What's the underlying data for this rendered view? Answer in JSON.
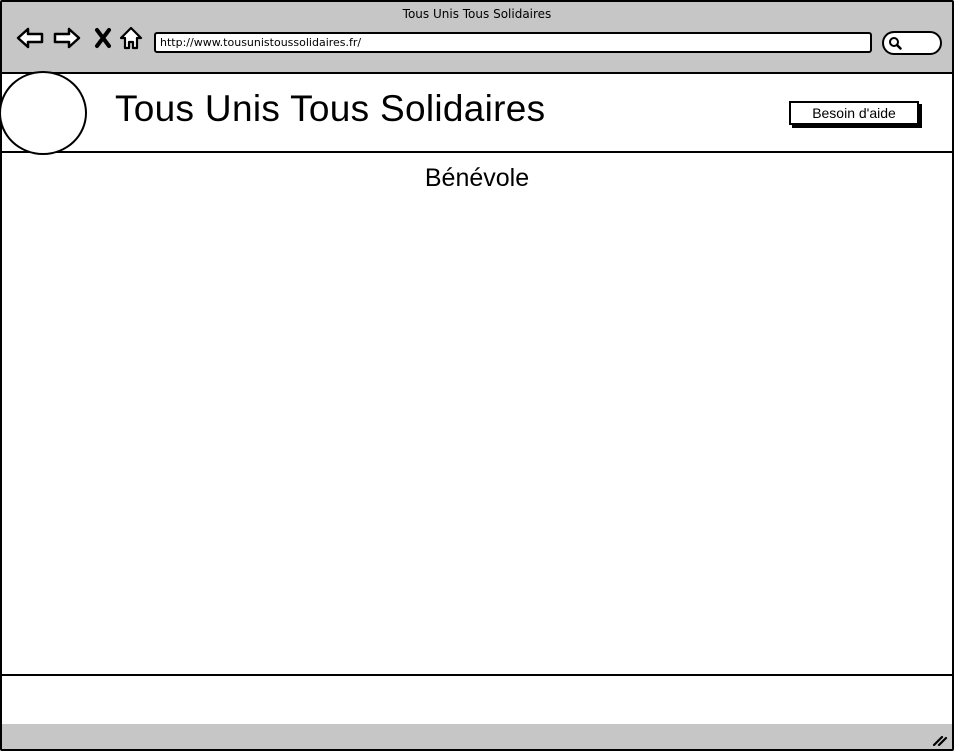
{
  "window": {
    "title": "Tous Unis Tous Solidaires"
  },
  "browser": {
    "url": "http://www.tousunistoussolidaires.fr/",
    "icons": [
      "back-arrow-icon",
      "forward-arrow-icon",
      "close-x-icon",
      "home-icon",
      "search-icon",
      "resize-grip-icon"
    ]
  },
  "header": {
    "title": "Tous Unis Tous Solidaires",
    "help_button_label": "Besoin d'aide"
  },
  "main": {
    "heading": "Bénévole"
  },
  "colors": {
    "chrome": "#c6c6c6",
    "outline": "#000000",
    "background": "#ffffff"
  }
}
